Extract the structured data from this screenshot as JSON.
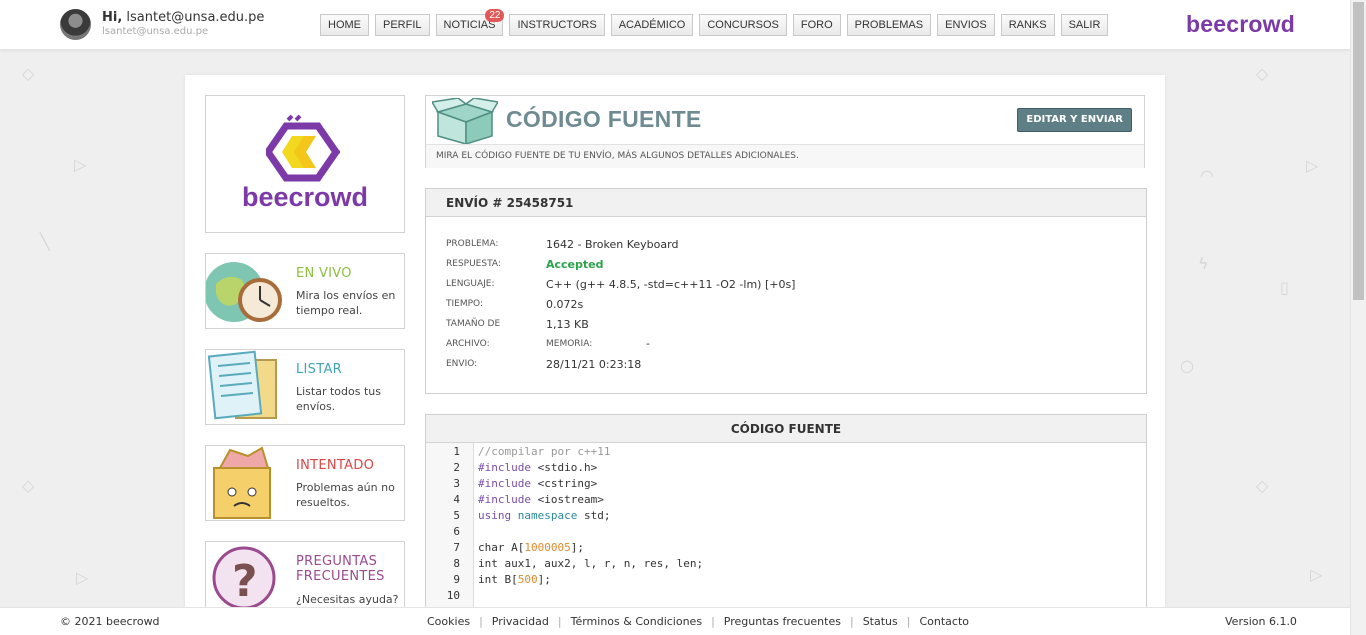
{
  "header": {
    "greeting": "Hi,",
    "user_email": "lsantet@unsa.edu.pe",
    "user_sub": "lsantet@unsa.edu.pe",
    "brand": "beecrowd",
    "nav": [
      {
        "label": "HOME"
      },
      {
        "label": "PERFIL"
      },
      {
        "label": "NOTICIAS",
        "badge": "22"
      },
      {
        "label": "INSTRUCTORS"
      },
      {
        "label": "ACADÉMICO"
      },
      {
        "label": "CONCURSOS"
      },
      {
        "label": "FORO"
      },
      {
        "label": "PROBLEMAS"
      },
      {
        "label": "ENVIOS"
      },
      {
        "label": "RANKS"
      },
      {
        "label": "SALIR"
      }
    ]
  },
  "sidebar": {
    "logo_text": "beecrowd",
    "cards": [
      {
        "title": "EN VIVO",
        "desc": "Mira los envíos en tiempo real.",
        "color": "#8bbf3f"
      },
      {
        "title": "LISTAR",
        "desc": "Listar todos tus envíos.",
        "color": "#3fa5b5"
      },
      {
        "title": "INTENTADO",
        "desc": "Problemas aún no resueltos.",
        "color": "#e04545"
      },
      {
        "title": "PREGUNTAS FRECUENTES",
        "desc": "¿Necesitas ayuda?",
        "color": "#9b4a8e"
      }
    ]
  },
  "page": {
    "title": "CÓDIGO FUENTE",
    "edit_button": "EDITAR Y ENVIAR",
    "subtitle": "MIRA EL CÓDIGO FUENTE DE TU ENVÍO, MÁS ALGUNOS DETALLES ADICIONALES."
  },
  "submission": {
    "heading": "ENVÍO # 25458751",
    "problem_label": "PROBLEMA:",
    "problem_value": "1642 - Broken Keyboard",
    "answer_label": "RESPUESTA:",
    "answer_value": "Accepted",
    "language_label": "LENGUAJE:",
    "language_value": "C++ (g++ 4.8.5, -std=c++11 -O2 -lm) [+0s]",
    "time_label": "TIEMPO:",
    "time_value": "0.072s",
    "size_label": "TAMAÑO DE",
    "size_value": "1,13 KB",
    "file_label": "ARCHIVO:",
    "memory_label": "MEMORIA:",
    "memory_value": "-",
    "sent_label": "ENVIO:",
    "sent_value": "28/11/21 0:23:18"
  },
  "code": {
    "heading": "CÓDIGO FUENTE",
    "lines": [
      {
        "num": "1",
        "text": "//compilar por c++11"
      },
      {
        "num": "2",
        "text": "#include <stdio.h>"
      },
      {
        "num": "3",
        "text": "#include <cstring>"
      },
      {
        "num": "4",
        "text": "#include <iostream>"
      },
      {
        "num": "5",
        "text": "using namespace std;"
      },
      {
        "num": "6",
        "text": ""
      },
      {
        "num": "7",
        "text": "char A[1000005];"
      },
      {
        "num": "8",
        "text": "int aux1, aux2, l, r, n, res, len;"
      },
      {
        "num": "9",
        "text": "int B[500];"
      },
      {
        "num": "10",
        "text": ""
      }
    ]
  },
  "footer": {
    "copyright": "© 2021 beecrowd",
    "links": [
      "Cookies",
      "Privacidad",
      "Términos & Condiciones",
      "Preguntas frecuentes",
      "Status",
      "Contacto"
    ],
    "version": "Version 6.1.0"
  }
}
